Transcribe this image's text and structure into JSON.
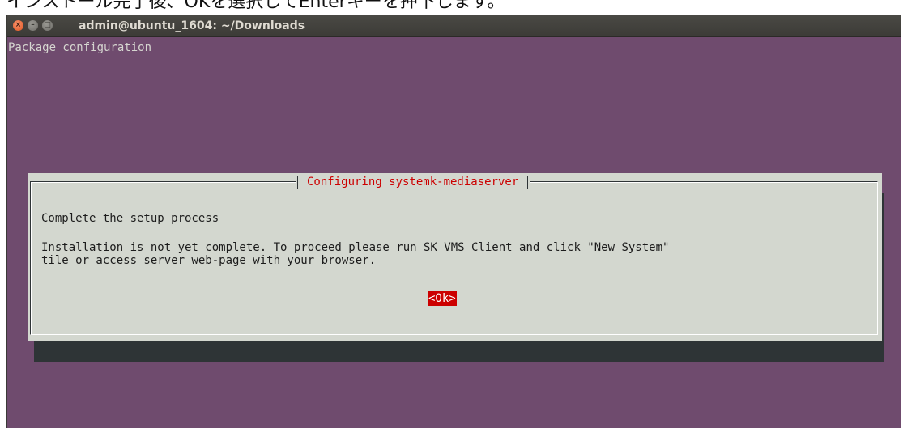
{
  "caption": {
    "text": "インストール完了後、OKを選択してEnterキーを押下します。"
  },
  "window": {
    "title": "admin@ubuntu_1604: ~/Downloads",
    "buttons": {
      "close": "×",
      "minimize": "–",
      "maximize": "□"
    }
  },
  "terminal": {
    "header": "Package configuration",
    "background_color": "#6f4b6e"
  },
  "dialog": {
    "title": "Configuring systemk-mediaserver",
    "heading": "Complete the setup process",
    "message_line1": "Installation is not yet complete. To proceed please run SK VMS Client and click \"New System\"",
    "message_line2": "tile or access server web-page with your browser.",
    "ok_label": "<Ok>",
    "accent_color": "#cc0000"
  }
}
